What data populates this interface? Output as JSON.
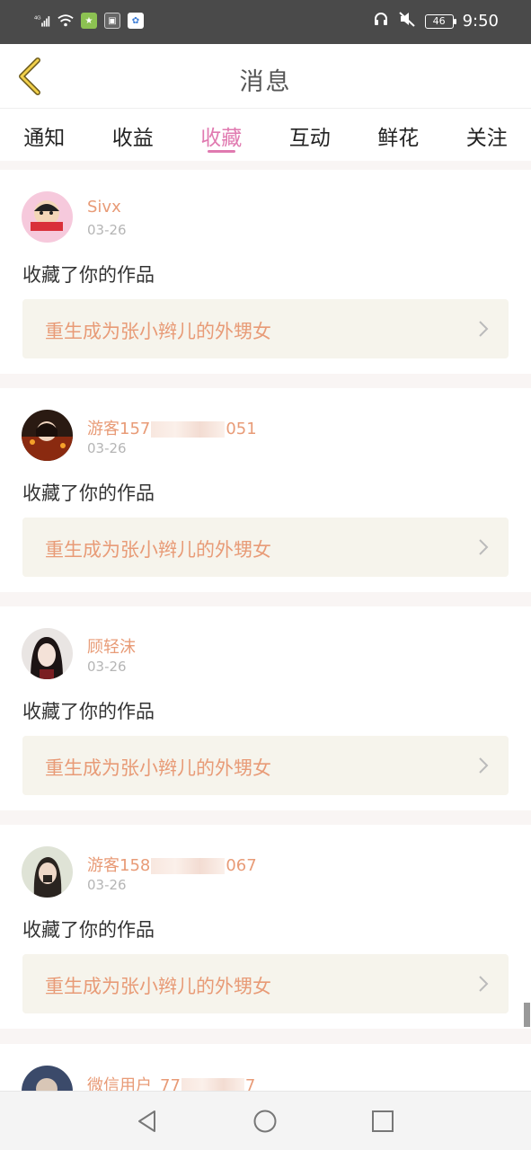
{
  "status_bar": {
    "network": "4G",
    "battery": "46",
    "time": "9:50"
  },
  "header": {
    "title": "消息",
    "back_icon": "chevron-left-icon"
  },
  "tabs": [
    {
      "label": "通知",
      "active": false
    },
    {
      "label": "收益",
      "active": false
    },
    {
      "label": "收藏",
      "active": true
    },
    {
      "label": "互动",
      "active": false
    },
    {
      "label": "鲜花",
      "active": false
    },
    {
      "label": "关注",
      "active": false
    }
  ],
  "feed": [
    {
      "user_prefix": "Sivx",
      "user_suffix": "",
      "masked": false,
      "date": "03-26",
      "action": "收藏了你的作品",
      "work_title": "重生成为张小辫儿的外甥女"
    },
    {
      "user_prefix": "游客157",
      "user_suffix": "051",
      "masked": true,
      "date": "03-26",
      "action": "收藏了你的作品",
      "work_title": "重生成为张小辫儿的外甥女"
    },
    {
      "user_prefix": "顾轻沫",
      "user_suffix": "",
      "masked": false,
      "date": "03-26",
      "action": "收藏了你的作品",
      "work_title": "重生成为张小辫儿的外甥女"
    },
    {
      "user_prefix": "游客158",
      "user_suffix": "067",
      "masked": true,
      "date": "03-26",
      "action": "收藏了你的作品",
      "work_title": "重生成为张小辫儿的外甥女"
    }
  ],
  "partial_item": {
    "user_prefix": "微信用户_77",
    "user_suffix": "7"
  },
  "colors": {
    "accent": "#e07ab0",
    "username": "#e89b77",
    "work_box_bg": "#f6f4ec",
    "statusbar": "#4a4a4a"
  }
}
